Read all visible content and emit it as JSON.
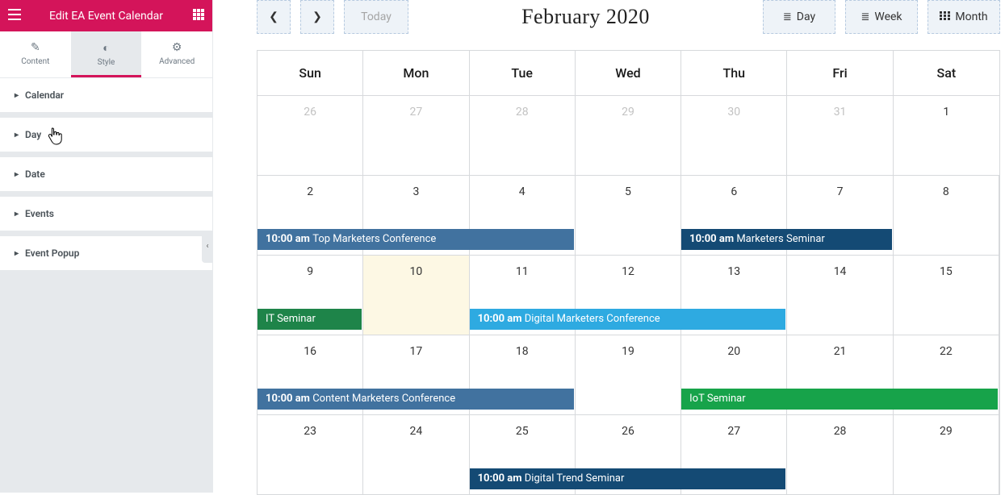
{
  "header": {
    "title": "Edit EA Event Calendar"
  },
  "tabs": [
    {
      "label": "Content"
    },
    {
      "label": "Style"
    },
    {
      "label": "Advanced"
    }
  ],
  "accordion": [
    {
      "label": "Calendar"
    },
    {
      "label": "Day"
    },
    {
      "label": "Date"
    },
    {
      "label": "Events"
    },
    {
      "label": "Event Popup"
    }
  ],
  "toolbar": {
    "today": "Today",
    "title": "February 2020",
    "views": {
      "day": "Day",
      "week": "Week",
      "month": "Month"
    }
  },
  "daynames": [
    "Sun",
    "Mon",
    "Tue",
    "Wed",
    "Thu",
    "Fri",
    "Sat"
  ],
  "weeks": [
    {
      "nums": [
        "26",
        "27",
        "28",
        "29",
        "30",
        "31",
        "1"
      ],
      "other": [
        true,
        true,
        true,
        true,
        true,
        true,
        false
      ],
      "today": -1
    },
    {
      "nums": [
        "2",
        "3",
        "4",
        "5",
        "6",
        "7",
        "8"
      ],
      "other": [
        false,
        false,
        false,
        false,
        false,
        false,
        false
      ],
      "today": -1
    },
    {
      "nums": [
        "9",
        "10",
        "11",
        "12",
        "13",
        "14",
        "15"
      ],
      "other": [
        false,
        false,
        false,
        false,
        false,
        false,
        false
      ],
      "today": 1
    },
    {
      "nums": [
        "16",
        "17",
        "18",
        "19",
        "20",
        "21",
        "22"
      ],
      "other": [
        false,
        false,
        false,
        false,
        false,
        false,
        false
      ],
      "today": -1
    },
    {
      "nums": [
        "23",
        "24",
        "25",
        "26",
        "27",
        "28",
        "29"
      ],
      "other": [
        false,
        false,
        false,
        false,
        false,
        false,
        false
      ],
      "today": -1
    }
  ],
  "events": {
    "w1a": {
      "time": "10:00 am",
      "title": "Top Marketers Conference"
    },
    "w1b": {
      "time": "10:00 am",
      "title": "Marketers Seminar"
    },
    "w2a": {
      "title": "IT Seminar"
    },
    "w2b": {
      "time": "10:00 am",
      "title": "Digital Marketers Conference"
    },
    "w3a": {
      "time": "10:00 am",
      "title": "Content Marketers Conference"
    },
    "w3b": {
      "title": "IoT Seminar"
    },
    "w4a": {
      "time": "10:00 am",
      "title": "Digital Trend Seminar"
    }
  }
}
